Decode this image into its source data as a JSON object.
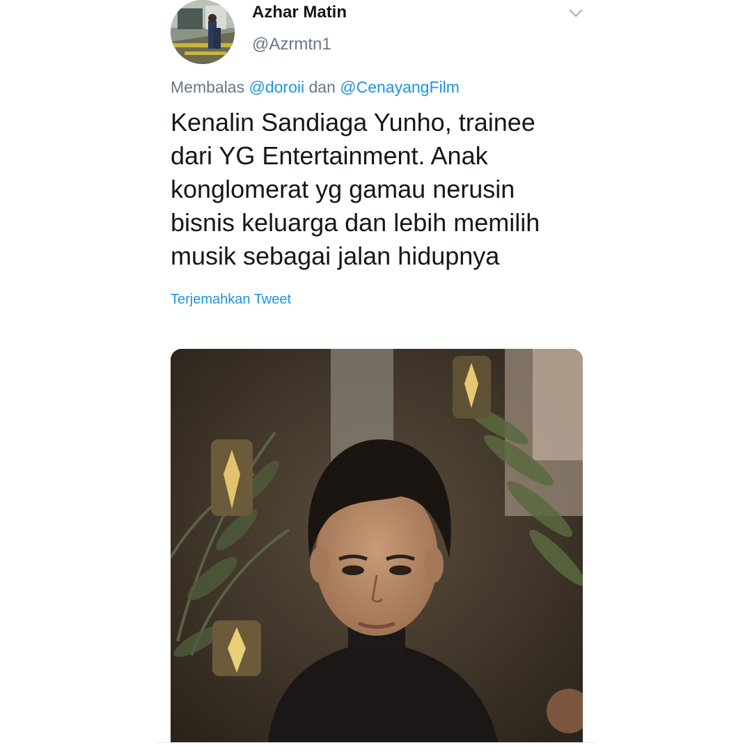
{
  "tweet": {
    "author": {
      "display_name": "Azhar Matin",
      "handle": "@Azrmtn1"
    },
    "reply_context": {
      "prefix": "Membalas",
      "mention_1": "@doroii",
      "conjunction": "dan",
      "mention_2": "@CenayangFilm"
    },
    "text_lines": [
      "Kenalin Sandiaga Yunho, trainee",
      "dari YG Entertainment. Anak",
      "konglomerat yg gamau nerusin",
      "bisnis keluarga dan lebih memilih",
      "musik sebagai jalan hidupnya"
    ],
    "translate_label": "Terjemahkan Tweet",
    "icons": {
      "menu": "chevron-down-icon"
    }
  },
  "colors": {
    "primary_text": "#14171a",
    "secondary_text": "#657786",
    "link": "#1b95e0",
    "divider": "#e6ecf0"
  }
}
